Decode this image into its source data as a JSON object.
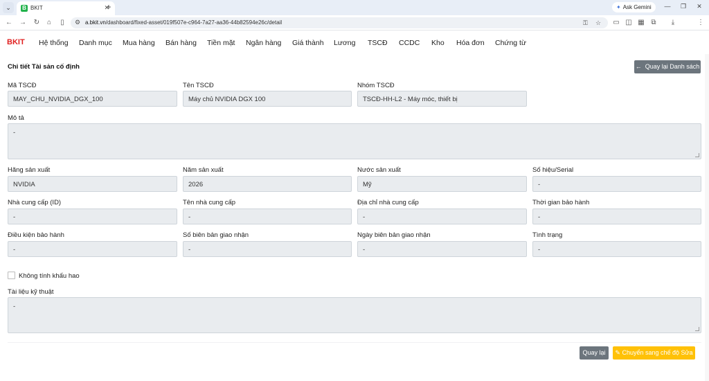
{
  "browser": {
    "tab_title": "BKIT",
    "tab_favicon": "B",
    "new_tab": "+",
    "ask_gemini": "Ask Gemini",
    "url_host": "a.bkit.vn",
    "url_path": "/dashboard/fixed-asset/019f507e-c964-7a27-aa36-44b82594e26c/detail"
  },
  "nav": {
    "brand": "BKIT",
    "items": [
      "Hệ thống",
      "Danh mục",
      "Mua hàng",
      "Bán hàng",
      "Tiền mặt",
      "Ngân hàng",
      "Giá thành",
      "Lương",
      "TSCĐ",
      "CCDC",
      "Kho",
      "Hóa đơn",
      "Chứng từ"
    ]
  },
  "page": {
    "title": "Chi tiết Tài sản cố định",
    "back_list_label": "Quay lại Danh sách"
  },
  "form": {
    "ma_tscd": {
      "label": "Mã TSCĐ",
      "value": "MAY_CHU_NVIDIA_DGX_100"
    },
    "ten_tscd": {
      "label": "Tên TSCĐ",
      "value": "Máy chủ NVIDIA DGX 100"
    },
    "nhom_tscd": {
      "label": "Nhóm TSCĐ",
      "value": "TSCĐ-HH-L2 - Máy móc, thiết bị"
    },
    "mo_ta": {
      "label": "Mô tả",
      "value": "-"
    },
    "hang_san_xuat": {
      "label": "Hãng sản xuất",
      "value": "NVIDIA"
    },
    "nam_san_xuat": {
      "label": "Năm sản xuất",
      "value": "2026"
    },
    "nuoc_san_xuat": {
      "label": "Nước sản xuất",
      "value": "Mỹ"
    },
    "so_hieu": {
      "label": "Số hiệu/Serial",
      "value": "-"
    },
    "nha_cung_cap_id": {
      "label": "Nhà cung cấp (ID)",
      "value": "-"
    },
    "ten_nha_cung_cap": {
      "label": "Tên nhà cung cấp",
      "value": "-"
    },
    "dia_chi_nha_cung_cap": {
      "label": "Địa chỉ nhà cung cấp",
      "value": "-"
    },
    "thoi_gian_bao_hanh": {
      "label": "Thời gian bảo hành",
      "value": "-"
    },
    "dieu_kien_bao_hanh": {
      "label": "Điều kiện bảo hành",
      "value": "-"
    },
    "so_bien_ban": {
      "label": "Số biên bản giao nhận",
      "value": "-"
    },
    "ngay_bien_ban": {
      "label": "Ngày biên bản giao nhận",
      "value": "-"
    },
    "tinh_trang": {
      "label": "Tình trạng",
      "value": "-"
    },
    "khong_tinh_khau_hao": {
      "label": "Không tính khấu hao",
      "checked": false
    },
    "tai_lieu_ky_thuat": {
      "label": "Tài liệu kỹ thuật",
      "value": "-"
    }
  },
  "actions": {
    "back_label": "Quay lại",
    "edit_label": "Chuyển sang chế độ Sửa"
  },
  "colors": {
    "brand": "#e02020",
    "secondary_button": "#6c757d",
    "warning_button": "#ffc107",
    "field_bg": "#e9ecef"
  }
}
